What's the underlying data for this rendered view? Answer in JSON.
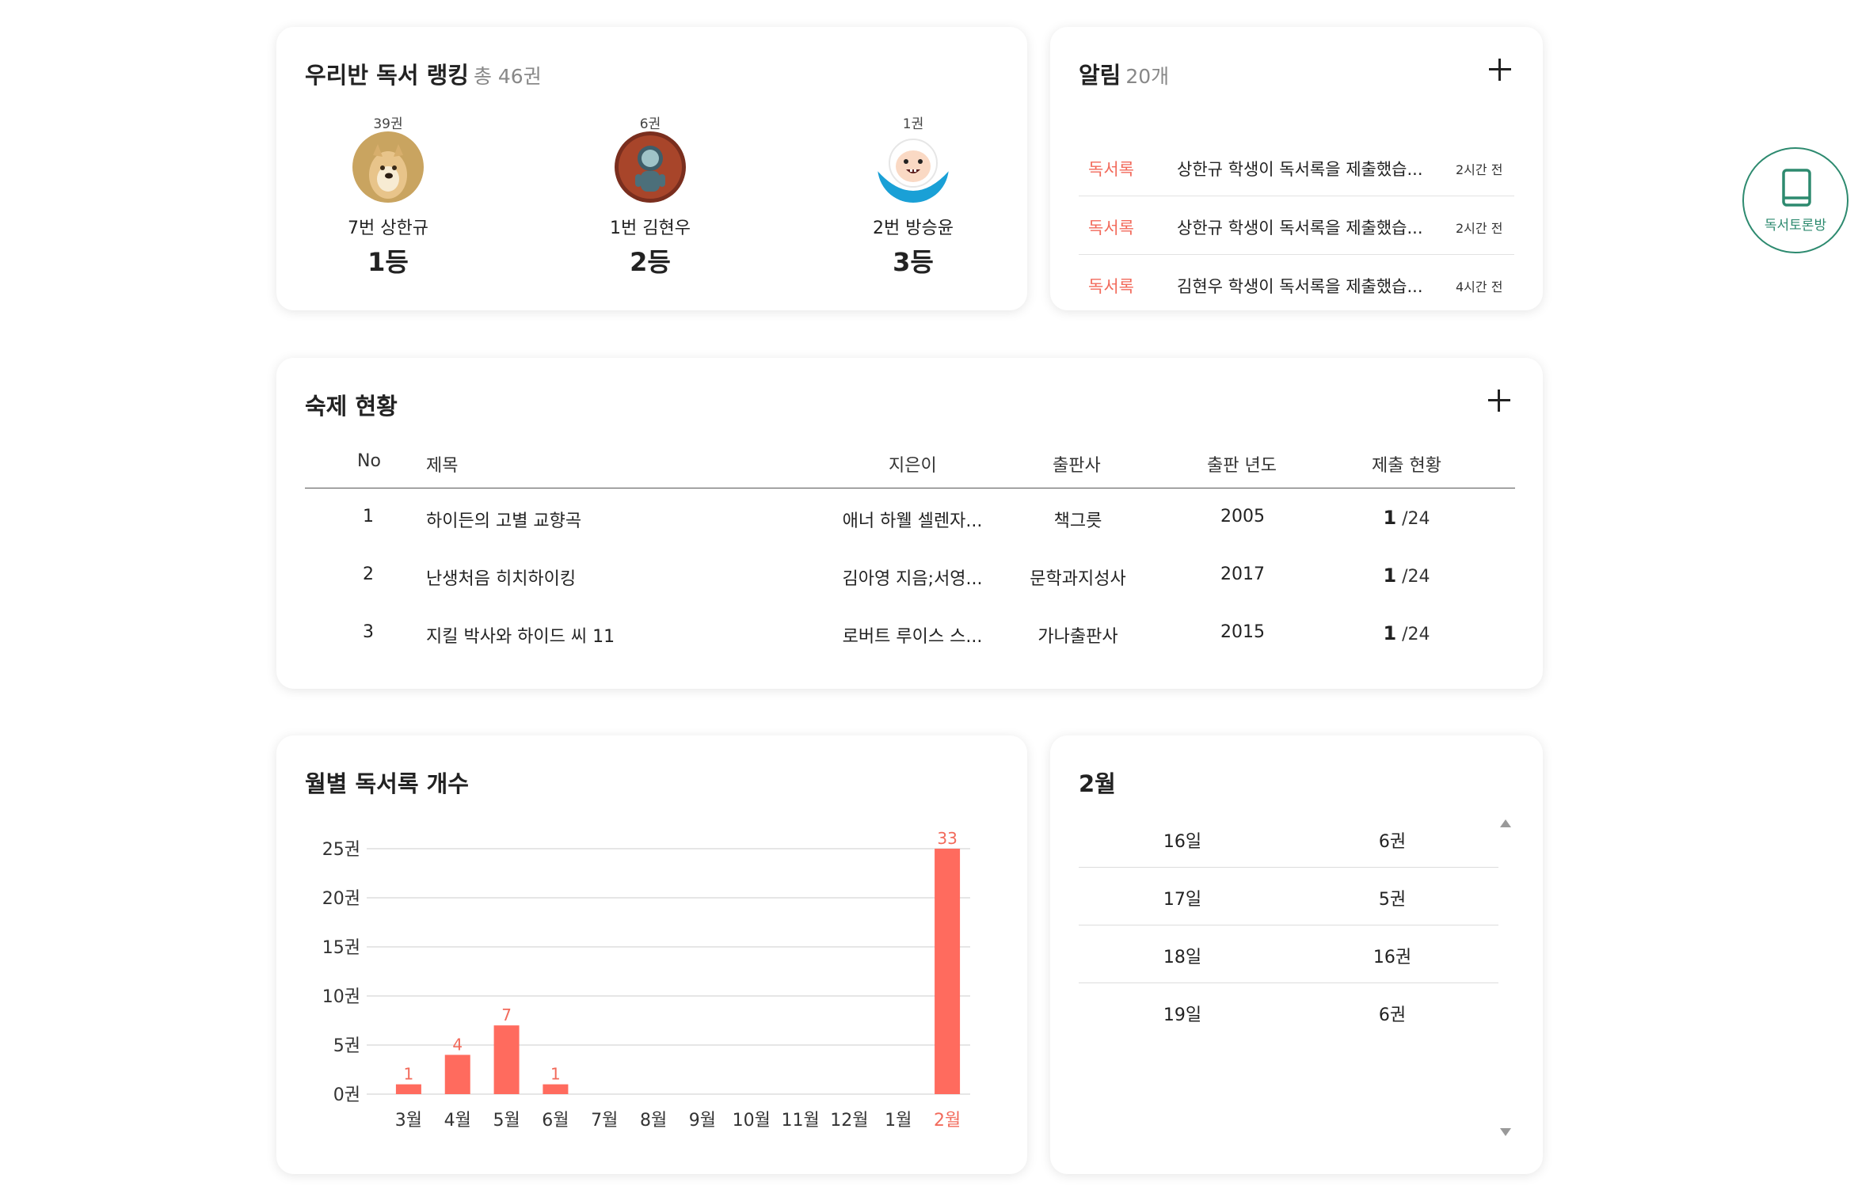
{
  "ranking": {
    "title": "우리반 독서 랭킹",
    "total": "총 46권",
    "entries": [
      {
        "count": "39권",
        "name": "7번 상한규",
        "place": "1등",
        "avatar": "dog-avatar-icon"
      },
      {
        "count": "6권",
        "name": "1번 김현우",
        "place": "2등",
        "avatar": "astronaut-avatar-icon"
      },
      {
        "count": "1권",
        "name": "2번 방승윤",
        "place": "3등",
        "avatar": "cartoon-face-avatar-icon"
      }
    ]
  },
  "notifications": {
    "title": "알림",
    "count": "20개",
    "items": [
      {
        "tag": "독서록",
        "text": "상한규 학생이 독서록을 제출했습...",
        "time": "2시간 전"
      },
      {
        "tag": "독서록",
        "text": "상한규 학생이 독서록을 제출했습...",
        "time": "2시간 전"
      },
      {
        "tag": "독서록",
        "text": "김현우 학생이 독서록을 제출했습...",
        "time": "4시간 전"
      }
    ]
  },
  "fab": {
    "label": "독서토론방",
    "icon": "book-icon"
  },
  "homework": {
    "title": "숙제 현황",
    "headers": {
      "no": "No",
      "title": "제목",
      "author": "지은이",
      "publisher": "출판사",
      "year": "출판 년도",
      "status": "제출 현황"
    },
    "rows": [
      {
        "no": "1",
        "title": "하이든의 고별 교향곡",
        "author": "애너 하웰 셀렌자...",
        "publisher": "책그릇",
        "year": "2005",
        "submitted": "1",
        "total": "/24"
      },
      {
        "no": "2",
        "title": "난생처음 히치하이킹",
        "author": "김아영 지음;서영...",
        "publisher": "문학과지성사",
        "year": "2017",
        "submitted": "1",
        "total": "/24"
      },
      {
        "no": "3",
        "title": "지킬 박사와 하이드 씨 11",
        "author": "로버트 루이스 스...",
        "publisher": "가나출판사",
        "year": "2015",
        "submitted": "1",
        "total": "/24"
      }
    ]
  },
  "monthly": {
    "title": "월별 독서록 개수"
  },
  "chart_data": {
    "type": "bar",
    "title": "월별 독서록 개수",
    "categories": [
      "3월",
      "4월",
      "5월",
      "6월",
      "7월",
      "8월",
      "9월",
      "10월",
      "11월",
      "12월",
      "1월",
      "2월"
    ],
    "values": [
      1,
      4,
      7,
      1,
      0,
      0,
      0,
      0,
      0,
      0,
      0,
      33
    ],
    "data_labels": [
      "1",
      "4",
      "7",
      "1",
      "",
      "",
      "",
      "",
      "",
      "",
      "",
      "33"
    ],
    "y_ticks": [
      "0권",
      "5권",
      "10권",
      "15권",
      "20권",
      "25권"
    ],
    "ylim": [
      0,
      25
    ],
    "grid": true,
    "highlight_category": "2월",
    "colors": {
      "bar": "#ff6b5e",
      "label": "#f26a5b",
      "axis_text": "#333333",
      "grid": "#dddddd"
    }
  },
  "daily": {
    "title": "2월",
    "rows": [
      {
        "day": "16일",
        "count": "6권"
      },
      {
        "day": "17일",
        "count": "5권"
      },
      {
        "day": "18일",
        "count": "16권"
      },
      {
        "day": "19일",
        "count": "6권"
      }
    ]
  },
  "colors": {
    "accent": "#f26a5b",
    "fab": "#2d8a6f"
  }
}
